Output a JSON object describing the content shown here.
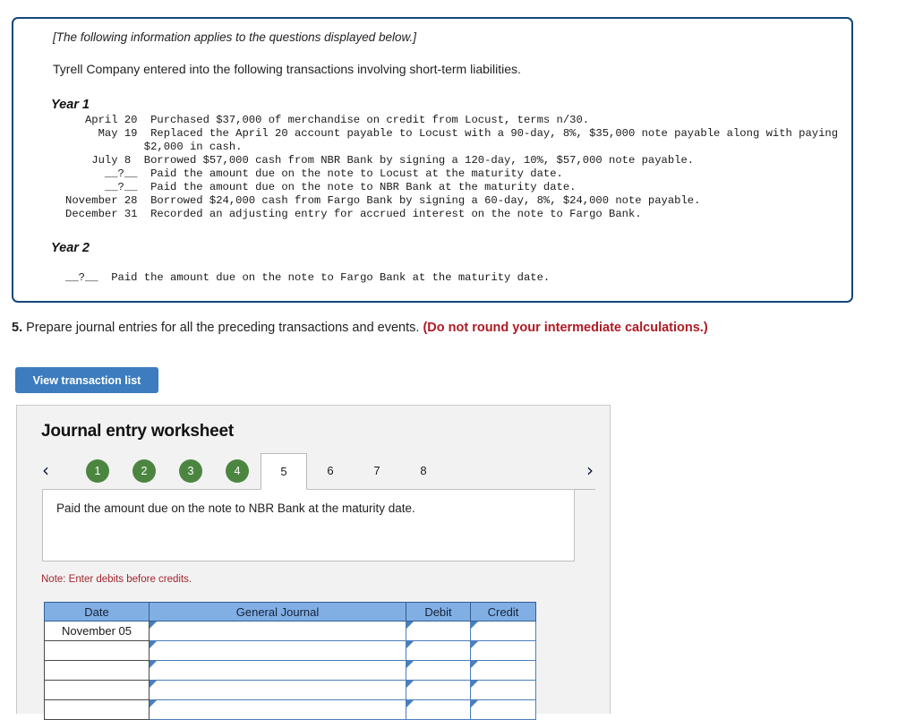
{
  "info_panel": {
    "intro_italic": "[The following information applies to the questions displayed below.]",
    "intro_line": "Tyrell Company entered into the following transactions involving short-term liabilities.",
    "year1_heading": "Year 1",
    "year1_rows": "   April 20  Purchased $37,000 of merchandise on credit from Locust, terms n/30.\n     May 19  Replaced the April 20 account payable to Locust with a 90-day, 8%, $35,000 note payable along with paying\n            $2,000 in cash.\n    July 8  Borrowed $57,000 cash from NBR Bank by signing a 120-day, 10%, $57,000 note payable.\n      __?__  Paid the amount due on the note to Locust at the maturity date.\n      __?__  Paid the amount due on the note to NBR Bank at the maturity date.\nNovember 28  Borrowed $24,000 cash from Fargo Bank by signing a 60-day, 8%, $24,000 note payable.\nDecember 31  Recorded an adjusting entry for accrued interest on the note to Fargo Bank.",
    "year2_heading": "Year 2",
    "year2_rows": "__?__  Paid the amount due on the note to Fargo Bank at the maturity date."
  },
  "question": {
    "number": "5.",
    "text": " Prepare journal entries for all the preceding transactions and events. ",
    "emphasis": "(Do not round your intermediate calculations.)"
  },
  "toolbar": {
    "view_transaction_list_label": "View transaction list"
  },
  "worksheet": {
    "title": "Journal entry worksheet",
    "prev_arrow": "‹",
    "next_arrow": "›",
    "tabs": [
      {
        "label": "1",
        "state": "done"
      },
      {
        "label": "2",
        "state": "done"
      },
      {
        "label": "3",
        "state": "done"
      },
      {
        "label": "4",
        "state": "done"
      },
      {
        "label": "5",
        "state": "active"
      },
      {
        "label": "6",
        "state": "plain"
      },
      {
        "label": "7",
        "state": "plain"
      },
      {
        "label": "8",
        "state": "plain"
      }
    ],
    "description": "Paid the amount due on the note to NBR Bank at the maturity date.",
    "note": "Note: Enter debits before credits.",
    "table": {
      "headers": [
        "Date",
        "General Journal",
        "Debit",
        "Credit"
      ],
      "rows": [
        {
          "date": "November 05",
          "general_journal": "",
          "debit": "",
          "credit": ""
        },
        {
          "date": "",
          "general_journal": "",
          "debit": "",
          "credit": ""
        },
        {
          "date": "",
          "general_journal": "",
          "debit": "",
          "credit": ""
        },
        {
          "date": "",
          "general_journal": "",
          "debit": "",
          "credit": ""
        },
        {
          "date": "",
          "general_journal": "",
          "debit": "",
          "credit": ""
        }
      ]
    }
  },
  "colors": {
    "info_border": "#14477a",
    "button_blue": "#3d7cbe",
    "tab_done_green": "#4c8540",
    "table_header_blue": "#81afe4",
    "emphasis_red": "#b01a24",
    "note_red": "#a3262f",
    "panel_gray": "#f2f2f2"
  }
}
